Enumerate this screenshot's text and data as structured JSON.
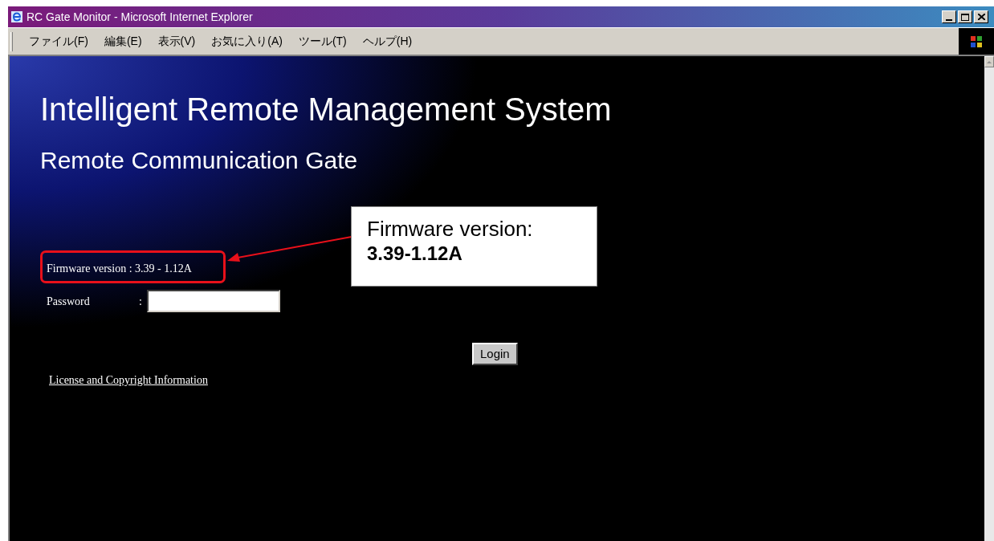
{
  "window": {
    "title": "RC Gate Monitor - Microsoft Internet Explorer"
  },
  "menu": [
    "ファイル(F)",
    "編集(E)",
    "表示(V)",
    "お気に入り(A)",
    "ツール(T)",
    "ヘルプ(H)"
  ],
  "page": {
    "heading": "Intelligent Remote Management System",
    "subheading": "Remote Communication Gate",
    "firmware": "Firmware version : 3.39 - 1.12A",
    "password_label": "Password",
    "password_colon": ":",
    "login_button": "Login",
    "license_link": "License and Copyright Information"
  },
  "annotation": {
    "title": "Firmware version:",
    "value": "3.39-1.12A"
  }
}
